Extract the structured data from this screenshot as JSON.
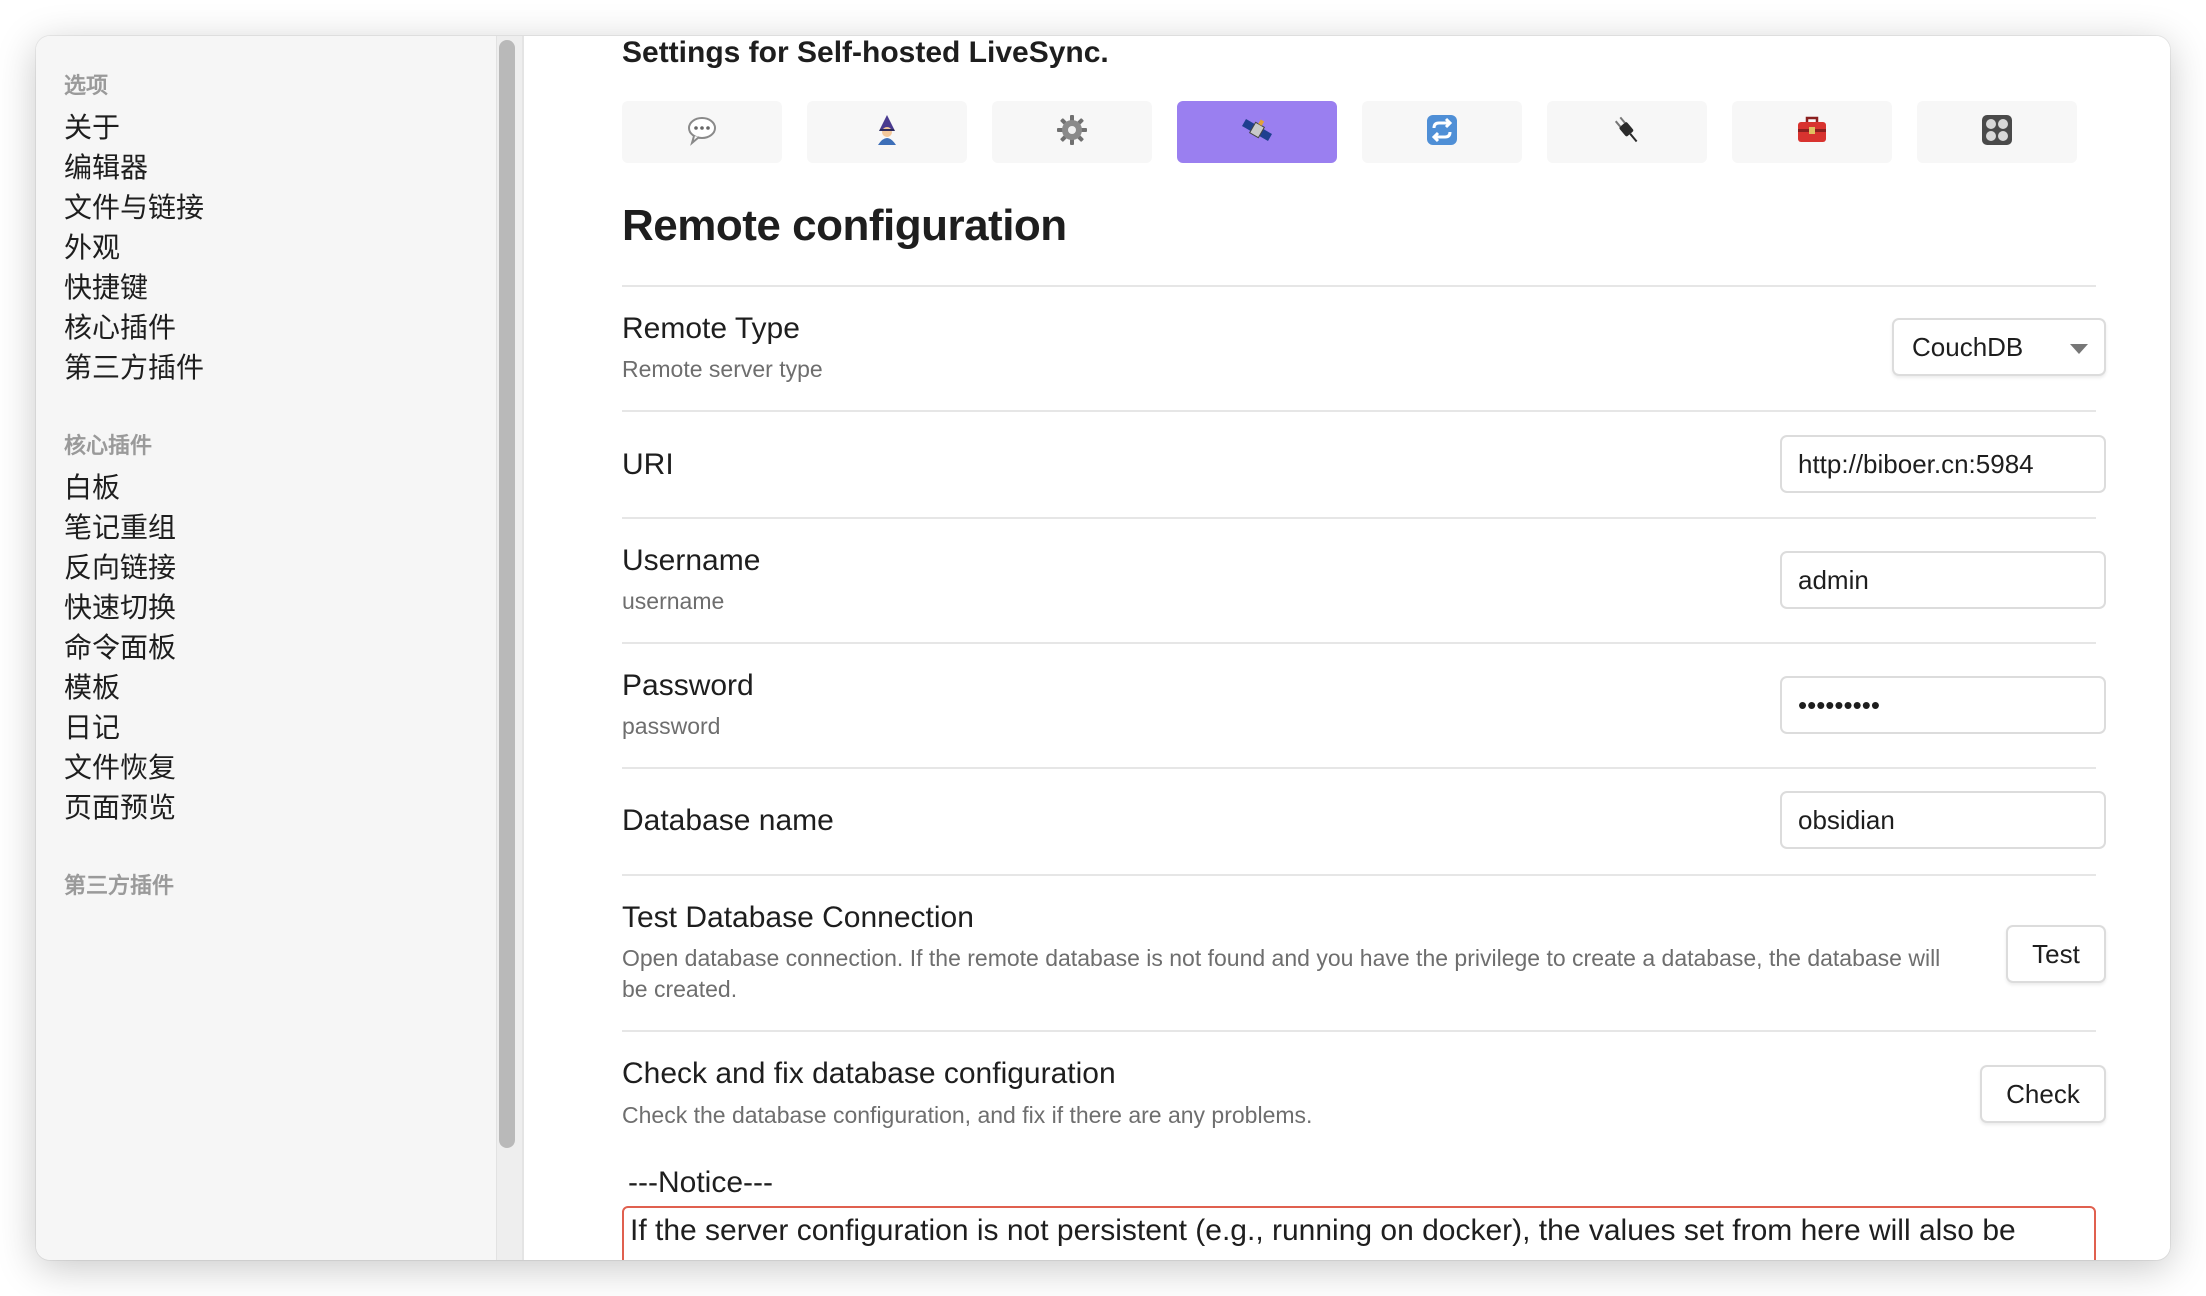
{
  "sidebar": {
    "sections": [
      {
        "title": "选项",
        "items": [
          "关于",
          "编辑器",
          "文件与链接",
          "外观",
          "快捷键",
          "核心插件",
          "第三方插件"
        ]
      },
      {
        "title": "核心插件",
        "items": [
          "白板",
          "笔记重组",
          "反向链接",
          "快速切换",
          "命令面板",
          "模板",
          "日记",
          "文件恢复",
          "页面预览"
        ]
      },
      {
        "title": "第三方插件",
        "items": []
      }
    ]
  },
  "header": {
    "title": "Settings for Self-hosted LiveSync."
  },
  "tabs": [
    {
      "icon": "speech-bubble-icon"
    },
    {
      "icon": "wizard-icon"
    },
    {
      "icon": "gear-icon"
    },
    {
      "icon": "satellite-icon",
      "active": true
    },
    {
      "icon": "sync-arrows-icon"
    },
    {
      "icon": "plug-icon"
    },
    {
      "icon": "toolbox-icon"
    },
    {
      "icon": "control-knobs-icon"
    }
  ],
  "section": {
    "title": "Remote configuration"
  },
  "settings": {
    "remote_type": {
      "name": "Remote Type",
      "desc": "Remote server type",
      "value": "CouchDB"
    },
    "uri": {
      "name": "URI",
      "value": "http://biboer.cn:5984"
    },
    "username": {
      "name": "Username",
      "desc": "username",
      "value": "admin"
    },
    "password": {
      "name": "Password",
      "desc": "password",
      "value": "•••••••••"
    },
    "database": {
      "name": "Database name",
      "value": "obsidian"
    },
    "test_connection": {
      "name": "Test Database Connection",
      "desc": "Open database connection. If the remote database is not found and you have the privilege to create a database, the database will be created.",
      "button": "Test"
    },
    "check_config": {
      "name": "Check and fix database configuration",
      "desc": "Check the database configuration, and fix if there are any problems.",
      "button": "Check"
    }
  },
  "notice": {
    "title": "---Notice---",
    "text": "If the server configuration is not persistent (e.g., running on docker), the values set from here will also be"
  },
  "colors": {
    "active_tab": "#9a7ff0",
    "notice_border": "#e0604f"
  }
}
